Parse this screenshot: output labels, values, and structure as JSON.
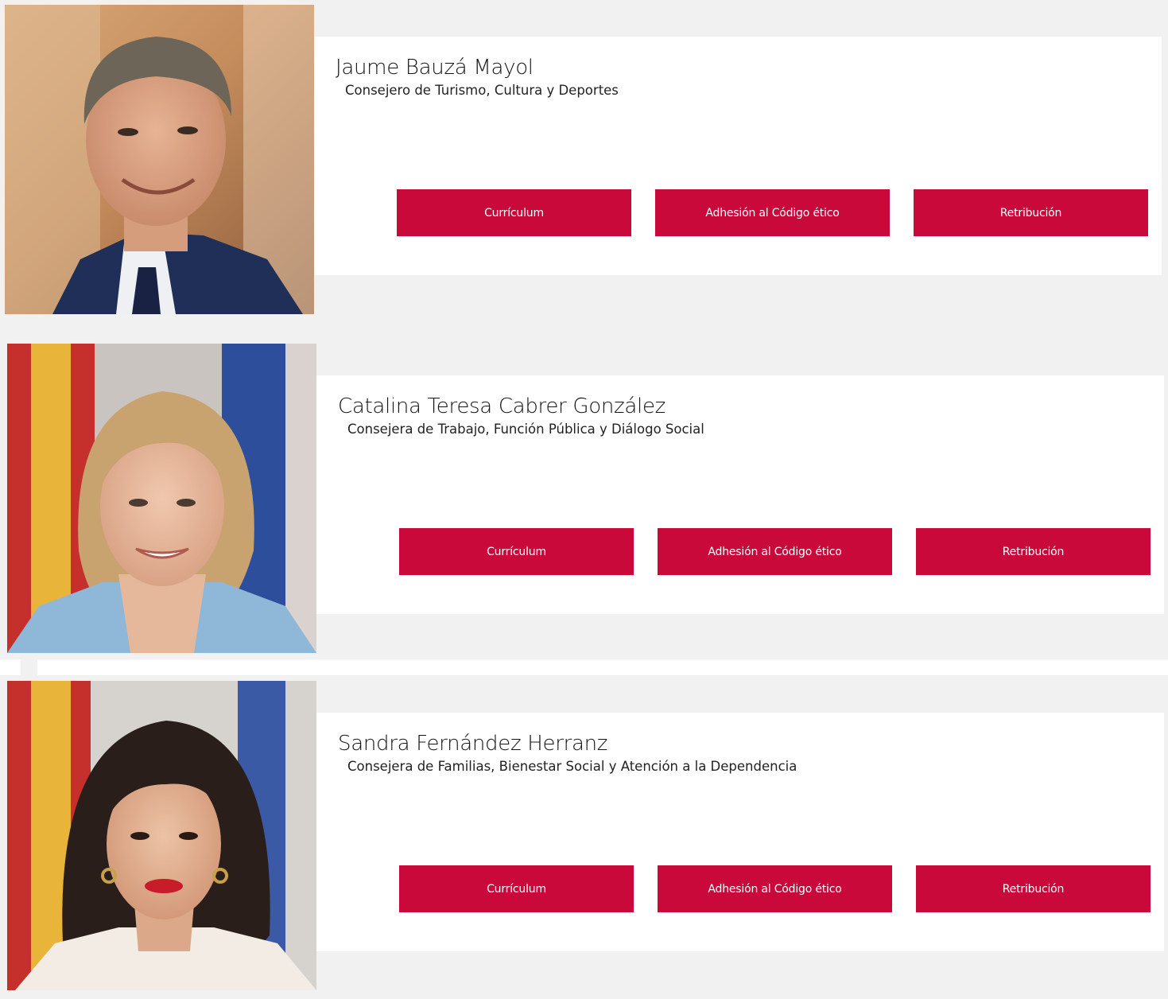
{
  "colors": {
    "page_background": "#f1f1f1",
    "panel_background": "#ffffff",
    "button_background": "#c8093a",
    "button_text": "#ffffff"
  },
  "members": [
    {
      "name": "Jaume Bauzá Mayol",
      "role": "Consejero de Turismo, Cultura y Deportes",
      "buttons": {
        "curriculum": "Currículum",
        "ethics": "Adhesión al Código ético",
        "salary": "Retribución"
      }
    },
    {
      "name": "Catalina Teresa Cabrer González",
      "role": "Consejera de Trabajo, Función Pública y Diálogo Social",
      "buttons": {
        "curriculum": "Currículum",
        "ethics": "Adhesión al Código ético",
        "salary": "Retribución"
      }
    },
    {
      "name": "Sandra Fernández Herranz",
      "role": "Consejera de Familias, Bienestar Social y Atención a la Dependencia",
      "buttons": {
        "curriculum": "Currículum",
        "ethics": "Adhesión al Código ético",
        "salary": "Retribución"
      }
    }
  ]
}
